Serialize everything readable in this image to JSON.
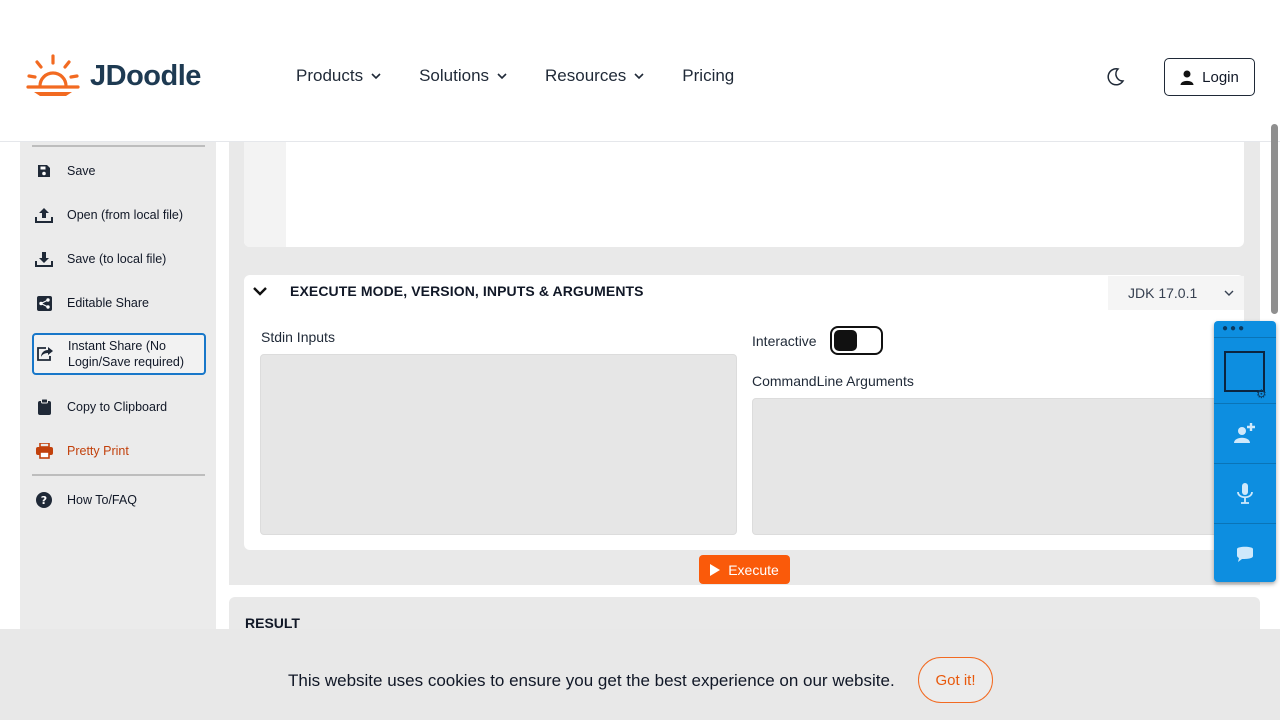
{
  "brand": {
    "name": "JDoodle",
    "accent": "#fa5a0a"
  },
  "nav": {
    "items": [
      {
        "label": "Products",
        "has_dropdown": true
      },
      {
        "label": "Solutions",
        "has_dropdown": true
      },
      {
        "label": "Resources",
        "has_dropdown": true
      },
      {
        "label": "Pricing",
        "has_dropdown": false
      }
    ],
    "theme_toggle_icon": "moon-icon",
    "login_label": "Login"
  },
  "sidebar": {
    "items": [
      {
        "label": "Save",
        "icon": "floppy-disk-icon"
      },
      {
        "label": "Open (from local file)",
        "icon": "upload-icon"
      },
      {
        "label": "Save (to local file)",
        "icon": "download-icon"
      },
      {
        "label": "Editable Share",
        "icon": "share-icon"
      },
      {
        "label": "Instant Share (No Login/Save required)",
        "icon": "share-square-icon"
      },
      {
        "label": "Copy to Clipboard",
        "icon": "clipboard-icon"
      },
      {
        "label": "Pretty Print",
        "icon": "printer-icon"
      },
      {
        "label": "How To/FAQ",
        "icon": "help-circle-icon"
      }
    ]
  },
  "execute_panel": {
    "title": "EXECUTE MODE, VERSION, INPUTS & ARGUMENTS",
    "version": "JDK 17.0.1",
    "stdin_label": "Stdin Inputs",
    "interactive_label": "Interactive",
    "interactive_on": false,
    "cmdline_label": "CommandLine Arguments",
    "execute_label": "Execute"
  },
  "result": {
    "label": "RESULT"
  },
  "cookie": {
    "message": "This website uses cookies to ensure you get the best experience on our website.",
    "button_label": "Got it!"
  }
}
